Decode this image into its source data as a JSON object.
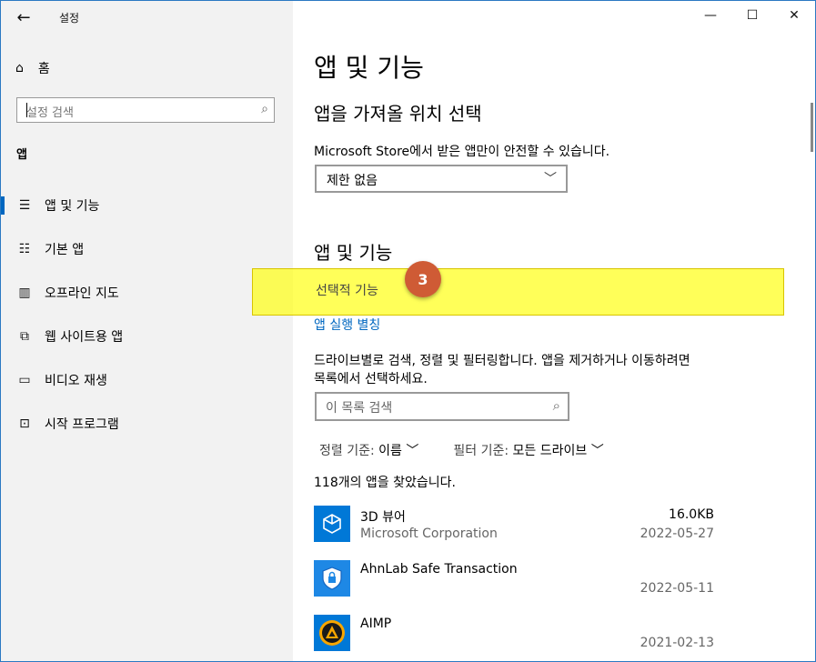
{
  "window": {
    "title": "설정"
  },
  "sidebar": {
    "home_label": "홈",
    "search_placeholder": "설정 검색",
    "section": "앱",
    "items": [
      {
        "label": "앱 및 기능",
        "icon": "list-icon",
        "selected": true
      },
      {
        "label": "기본 앱",
        "icon": "default-apps-icon",
        "selected": false
      },
      {
        "label": "오프라인 지도",
        "icon": "map-icon",
        "selected": false
      },
      {
        "label": "웹 사이트용 앱",
        "icon": "web-apps-icon",
        "selected": false
      },
      {
        "label": "비디오 재생",
        "icon": "video-icon",
        "selected": false
      },
      {
        "label": "시작 프로그램",
        "icon": "startup-icon",
        "selected": false
      }
    ]
  },
  "main": {
    "page_title": "앱 및 기능",
    "install_section": {
      "heading": "앱을 가져올 위치 선택",
      "description": "Microsoft Store에서 받은 앱만이 안전할 수 있습니다.",
      "dropdown_value": "제한 없음"
    },
    "apps_section": {
      "heading": "앱 및 기능",
      "optional_features_link": "선택적 기능",
      "aliases_link": "앱 실행 별칭",
      "instructions": [
        "드라이브별로 검색, 정렬 및 필터링합니다. 앱을 제거하거나 이동하려면",
        "목록에서 선택하세요."
      ],
      "list_search_placeholder": "이 목록 검색",
      "sort_label": "정렬 기준:",
      "sort_value": "이름",
      "filter_label": "필터 기준:",
      "filter_value": "모든 드라이브",
      "found_count_text": "118개의 앱을 찾았습니다."
    },
    "apps": [
      {
        "name": "3D 뷰어",
        "publisher": "Microsoft Corporation",
        "size": "16.0KB",
        "date": "2022-05-27",
        "icon": "cube-icon",
        "color": "#0078d7"
      },
      {
        "name": "AhnLab Safe Transaction",
        "publisher": "",
        "size": "",
        "date": "2022-05-11",
        "icon": "shield-icon",
        "color": "#1e88e5"
      },
      {
        "name": "AIMP",
        "publisher": "",
        "size": "",
        "date": "2021-02-13",
        "icon": "aimp-icon",
        "color": "#0078d7"
      }
    ]
  },
  "annotation": {
    "number": "3",
    "target": "선택적 기능"
  },
  "colors": {
    "accent": "#0067c0",
    "highlight": "#ffff00",
    "badge": "#cf5b35"
  }
}
